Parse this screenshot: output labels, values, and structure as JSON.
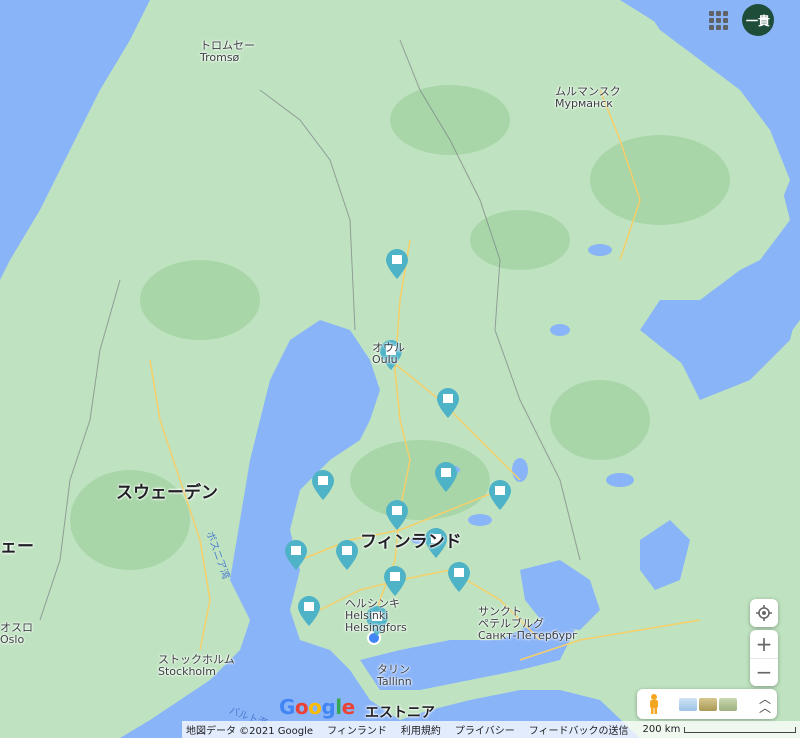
{
  "header": {
    "account_label": "一貴",
    "apps_icon": "apps-grid-icon"
  },
  "map": {
    "labels": {
      "finland": "フィンランド",
      "sweden": "スウェーデン",
      "norway_partial": "ェー",
      "tromso_ja": "トロムセー",
      "tromso_local": "Tromsø",
      "murmansk_ja": "ムルマンスク",
      "murmansk_local": "Мурманск",
      "oulu_ja": "オウル",
      "oulu_local": "Oulu",
      "helsinki_ja": "ヘルシンキ",
      "helsinki_local": "Helsinki",
      "helsingfors": "Helsingfors",
      "stpete_ja_1": "サンクト",
      "stpete_ja_2": "ペテルブルグ",
      "stpete_local": "Санкт-Петербург",
      "stockholm_ja": "ストックホルム",
      "stockholm_local": "Stockholm",
      "tallinn_ja": "タリン",
      "tallinn_local": "Tallinn",
      "oslo_ja": "オスロ",
      "oslo_local": "Oslo",
      "estonia": "エストニア",
      "bothnia": "ボスニア湾",
      "baltic": "バルト海"
    },
    "colors": {
      "water": "#8ab4f8",
      "land": "#bfe3c0",
      "land_dark": "#a8d6a8",
      "road": "#f5cf6a",
      "pin": "#4fb3c8"
    }
  },
  "controls": {
    "locate_icon": "my-location-icon",
    "zoom_in": "+",
    "zoom_out": "−",
    "expand_icon": "chevron-up-double-icon",
    "pegman_icon": "pegman-icon"
  },
  "footer": {
    "map_data": "地図データ ©2021 Google",
    "country": "フィンランド",
    "terms": "利用規約",
    "privacy": "プライバシー",
    "feedback": "フィードバックの送信",
    "scale": "200 km"
  },
  "logo": "Google"
}
